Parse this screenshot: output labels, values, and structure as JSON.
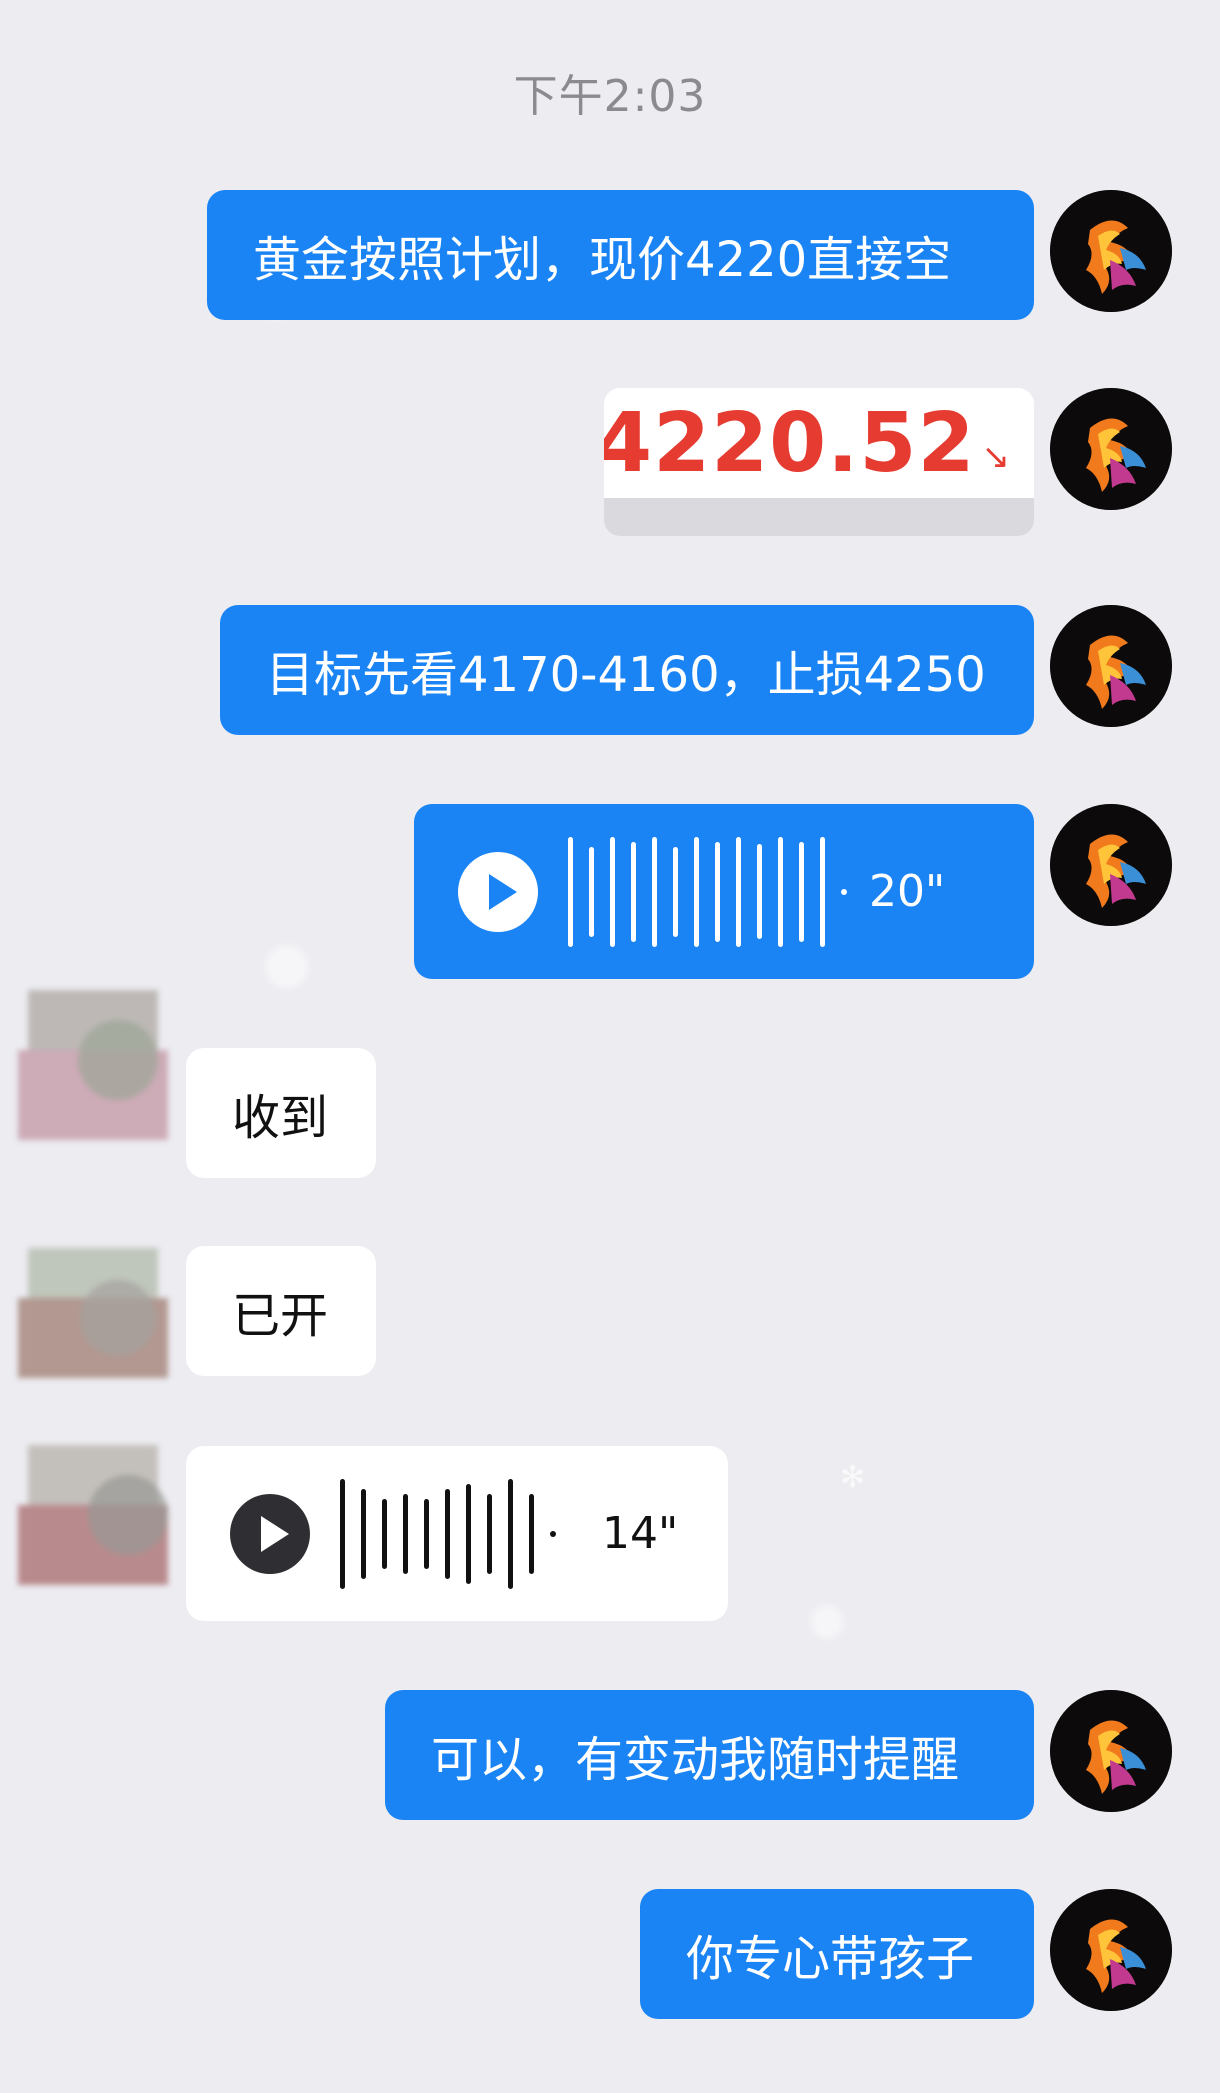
{
  "time_separator": "下午2:03",
  "messages": {
    "m1": "黄金按照计划，现价4220直接空",
    "m2_price": "4220.52",
    "m2_arrow": "↘",
    "m3": "目标先看4170-4160，止损4250",
    "m4_duration": "20\"",
    "m5": "收到",
    "m6": "已开",
    "m7_duration": "14\"",
    "m8": "可以，有变动我随时提醒",
    "m9": "你专心带孩子"
  },
  "colors": {
    "background": "#ececf1",
    "sent_bubble": "#1a84f5",
    "received_bubble": "#ffffff",
    "price_red": "#e63b30"
  },
  "icons": {
    "play": "play-icon",
    "waveform": "voice-wave-icon",
    "avatar": "flame-horse-avatar"
  }
}
